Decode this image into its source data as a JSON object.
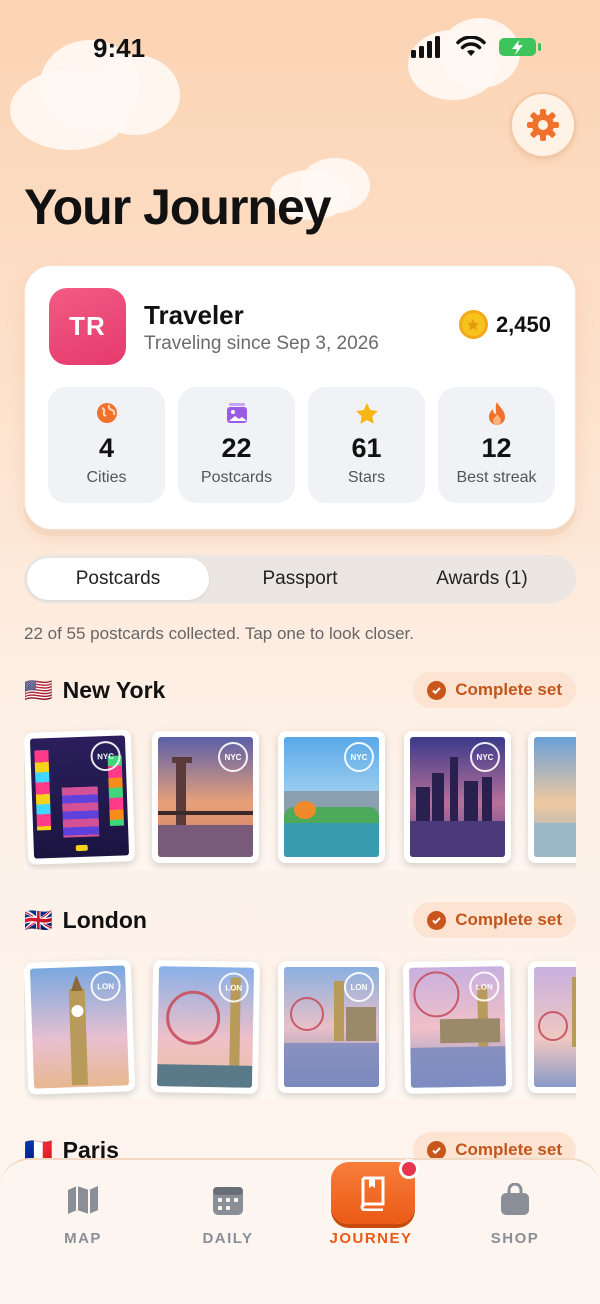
{
  "status_bar": {
    "time": "9:41"
  },
  "header": {
    "title": "Your Journey"
  },
  "profile": {
    "initials": "TR",
    "name": "Traveler",
    "since": "Traveling since Sep 3, 2026",
    "coins": "2,450",
    "stats": [
      {
        "value": "4",
        "label": "Cities",
        "icon": "globe-icon",
        "color": "#f0712c"
      },
      {
        "value": "22",
        "label": "Postcards",
        "icon": "postcard-icon",
        "color": "#9a5be8"
      },
      {
        "value": "61",
        "label": "Stars",
        "icon": "star-icon",
        "color": "#f7b516"
      },
      {
        "value": "12",
        "label": "Best streak",
        "icon": "flame-icon",
        "color": "#f0712c"
      }
    ]
  },
  "tabs": [
    {
      "label": "Postcards",
      "active": true
    },
    {
      "label": "Passport",
      "active": false
    },
    {
      "label": "Awards (1)",
      "active": false
    }
  ],
  "hint": "22 of 55 postcards collected. Tap one to look closer.",
  "sections": [
    {
      "flag": "🇺🇸",
      "city": "New York",
      "badge": "Complete set",
      "stamp": "NYC"
    },
    {
      "flag": "🇬🇧",
      "city": "London",
      "badge": "Complete set",
      "stamp": "LON"
    },
    {
      "flag": "🇫🇷",
      "city": "Paris",
      "badge": "Complete set"
    }
  ],
  "nav": [
    {
      "label": "MAP",
      "icon": "map-icon"
    },
    {
      "label": "DAILY",
      "icon": "calendar-icon"
    },
    {
      "label": "JOURNEY",
      "icon": "book-icon",
      "active": true
    },
    {
      "label": "SHOP",
      "icon": "bag-icon"
    }
  ],
  "colors": {
    "accent": "#ea5a16",
    "nav_inactive": "#8a8e96",
    "badge_text": "#c2561c"
  }
}
